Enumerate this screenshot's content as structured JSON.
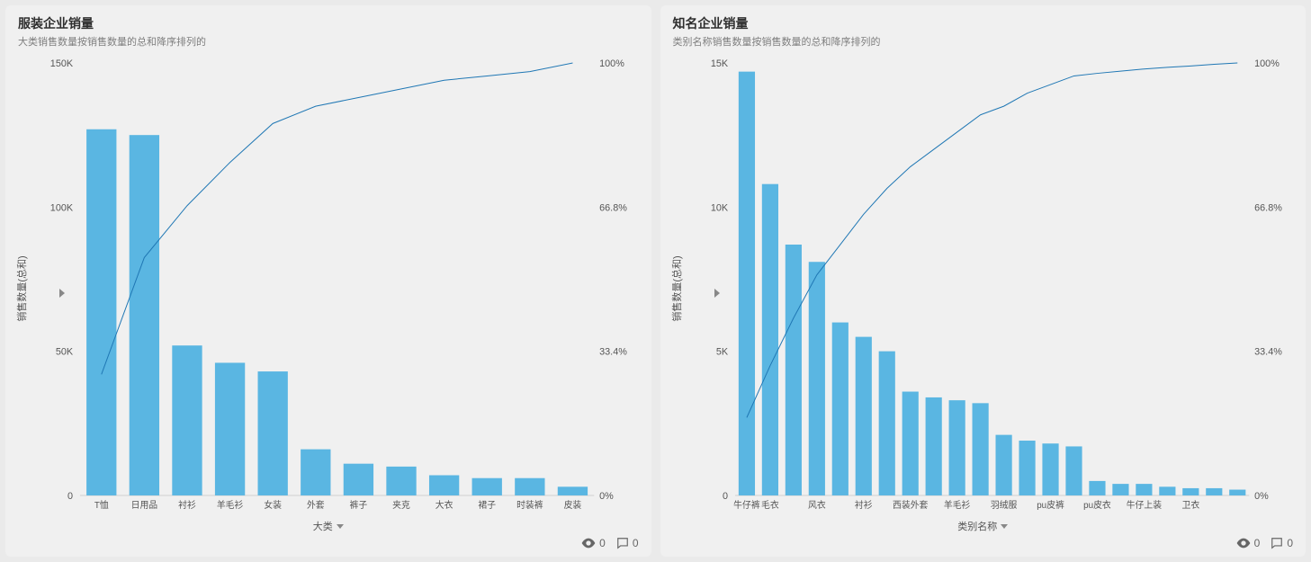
{
  "card_left": {
    "title": "服装企业销量",
    "subtitle": "大类销售数量按销售数量的总和降序排列的",
    "yaxis_label": "销售数量(总和)",
    "xaxis_label": "大类",
    "footer": {
      "views": 0,
      "comments": 0
    }
  },
  "card_right": {
    "title": "知名企业销量",
    "subtitle": "类别名称销售数量按销售数量的总和降序排列的",
    "yaxis_label": "销售数量(总和)",
    "xaxis_label": "类别名称",
    "footer": {
      "views": 0,
      "comments": 0
    }
  },
  "chart_data": [
    {
      "type": "bar",
      "title": "服装企业销量",
      "xlabel": "大类",
      "ylabel": "销售数量(总和)",
      "y_ticks": [
        "0",
        "50K",
        "100K",
        "150K"
      ],
      "ylim": [
        0,
        150000
      ],
      "y2_ticks": [
        "0%",
        "33.4%",
        "66.8%",
        "100%"
      ],
      "y2_label": "",
      "categories": [
        "T恤",
        "日用品",
        "衬衫",
        "羊毛衫",
        "女装",
        "外套",
        "裤子",
        "夹克",
        "大衣",
        "裙子",
        "时装裤",
        "皮装"
      ],
      "values": [
        127000,
        125000,
        52000,
        46000,
        43000,
        16000,
        11000,
        10000,
        7000,
        6000,
        6000,
        3000
      ],
      "cumulative_pct": [
        28,
        55,
        67,
        77,
        86,
        90,
        92,
        94,
        96,
        97,
        98,
        100
      ]
    },
    {
      "type": "bar",
      "title": "知名企业销量",
      "xlabel": "类别名称",
      "ylabel": "销售数量(总和)",
      "y_ticks": [
        "0",
        "5K",
        "10K",
        "15K"
      ],
      "ylim": [
        0,
        15000
      ],
      "y2_ticks": [
        "0%",
        "33.4%",
        "66.8%",
        "100%"
      ],
      "y2_label": "",
      "categories": [
        "牛仔裤",
        "毛衣",
        "风衣",
        "衬衫",
        "西装外套",
        "羊毛衫",
        "羽绒服",
        "pu皮裤",
        "pu皮衣",
        "牛仔上装",
        "卫衣"
      ],
      "values": [
        14700,
        10800,
        8700,
        8100,
        6000,
        5500,
        5000,
        3600,
        3400,
        3300,
        3200,
        2100,
        1900,
        1800,
        1700,
        500,
        400,
        400,
        300,
        250,
        250,
        200
      ],
      "categories_full": [
        "牛仔裤",
        "毛衣",
        "",
        "风衣",
        "",
        "衬衫",
        "",
        "西装外套",
        "",
        "羊毛衫",
        "",
        "羽绒服",
        "",
        "pu皮裤",
        "",
        "pu皮衣",
        "",
        "牛仔上装",
        "",
        "卫衣",
        "",
        ""
      ],
      "cumulative_pct": [
        18,
        30,
        41,
        51,
        58,
        65,
        71,
        76,
        80,
        84,
        88,
        90,
        93,
        95,
        97,
        97.6,
        98.1,
        98.6,
        99,
        99.3,
        99.7,
        100
      ]
    }
  ]
}
